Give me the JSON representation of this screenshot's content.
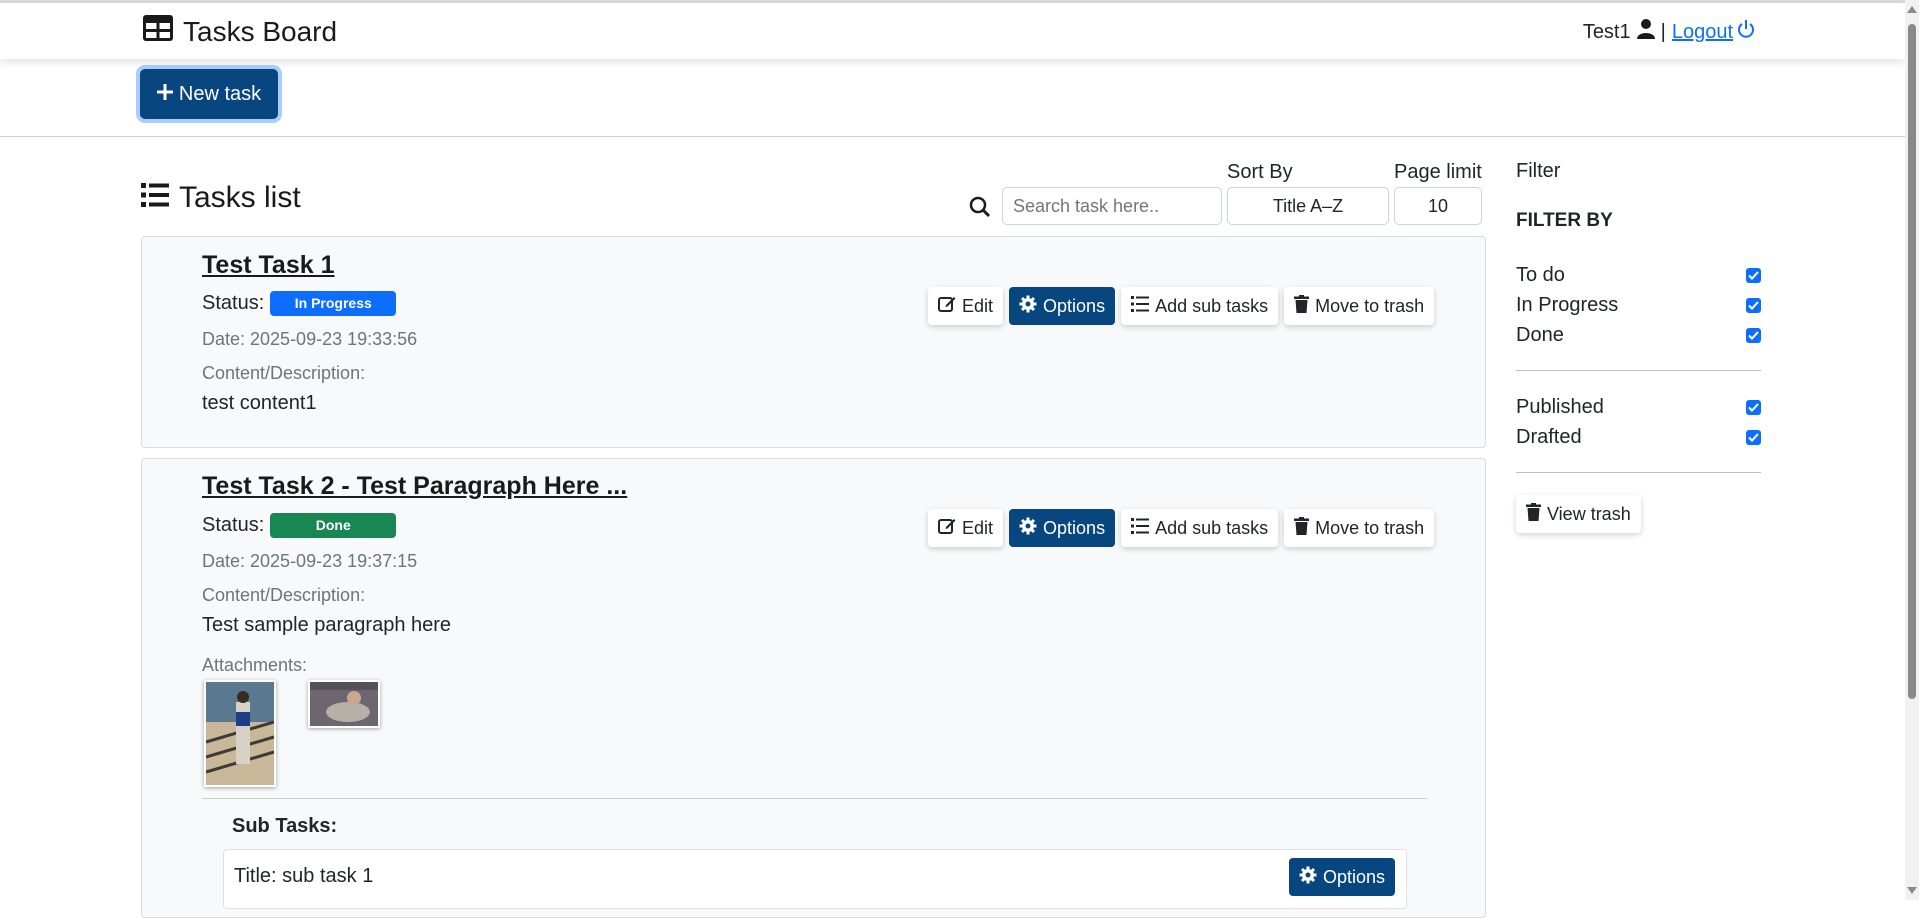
{
  "header": {
    "brand": "Tasks Board",
    "username": "Test1",
    "separator": "|",
    "logout": "Logout"
  },
  "toolbar": {
    "new_task": "New task"
  },
  "list": {
    "title": "Tasks list",
    "search_placeholder": "Search task here..",
    "sort_label": "Sort By",
    "sort_value": "Title A–Z",
    "limit_label": "Page limit",
    "limit_value": "10"
  },
  "labels": {
    "status": "Status:",
    "content": "Content/Description:",
    "attachments": "Attachments:",
    "subtasks": "Sub Tasks:",
    "edit": "Edit",
    "options": "Options",
    "add_sub": "Add sub tasks",
    "trash": "Move to trash"
  },
  "tasks": [
    {
      "title": "Test Task 1",
      "status": "In Progress",
      "status_color": "#0d6efd",
      "date": "Date: 2025-09-23 19:33:56",
      "content": "test content1"
    },
    {
      "title": "Test Task 2 - Test Paragraph Here ...",
      "status": "Done",
      "status_color": "#198754",
      "date": "Date: 2025-09-23 19:37:15",
      "content": "Test sample paragraph here",
      "subtask_title": "Title: sub task 1"
    }
  ],
  "filter": {
    "header": "Filter",
    "by": "FILTER BY",
    "status_options": [
      "To do",
      "In Progress",
      "Done"
    ],
    "publish_options": [
      "Published",
      "Drafted"
    ],
    "view_trash": "View trash"
  },
  "colors": {
    "primary": "#08467f",
    "accent": "#0d6efd"
  }
}
